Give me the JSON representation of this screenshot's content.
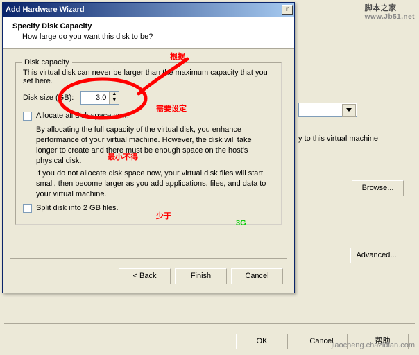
{
  "back_window": {
    "device_label": "y to this virtual machine",
    "browse_btn": "Browse...",
    "advanced_btn": "Advanced...",
    "ok_btn": "OK",
    "cancel_btn": "Cancel",
    "help_btn": "帮助"
  },
  "wizard": {
    "title": "Add Hardware Wizard",
    "header_title": "Specify Disk Capacity",
    "header_subtitle": "How large do you want this disk to be?",
    "group_title": "Disk capacity",
    "info_line": "This virtual disk can never be larger than the maximum capacity that you set here.",
    "disk_size_label": "Disk size (GB):",
    "disk_size_value": "3.0",
    "allocate_label": "Allocate all disk space now.",
    "allocate_desc": "By allocating the full capacity of the virtual disk, you enhance performance of your virtual machine. However, the disk will take longer to create and there must be enough space on the host's physical disk.",
    "allocate_warn": "If you do not allocate disk space now, your virtual disk files will start small, then become larger as you add applications, files, and data to your virtual machine.",
    "split_label": "Split disk into 2 GB files.",
    "back_btn_prefix": "< ",
    "back_btn": "Back",
    "finish_btn": "Finish",
    "cancel_btn": "Cancel"
  },
  "watermark": {
    "top_line1": "脚本之家",
    "top_line2": "www.Jb51.net",
    "bottom": "jiaocheng.chazidian.com"
  },
  "annotation": {
    "text_red1": "根据",
    "text_red2": "需要设定",
    "text_red3": "最小不得",
    "text_red4": "少于",
    "text_green": "3G"
  }
}
